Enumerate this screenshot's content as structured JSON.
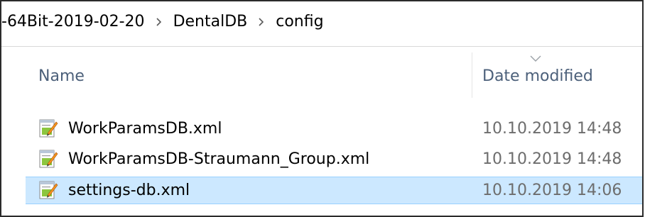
{
  "breadcrumb": {
    "items": [
      "-64Bit-2019-02-20",
      "DentalDB",
      "config"
    ]
  },
  "columns": {
    "name": "Name",
    "date_modified": "Date modified",
    "sort_icon": "chevron-down-icon"
  },
  "files": [
    {
      "name": "WorkParamsDB.xml",
      "date": "10.10.2019 14:48",
      "icon": "xml-notepad-file-icon",
      "selected": false
    },
    {
      "name": "WorkParamsDB-Straumann_Group.xml",
      "date": "10.10.2019 14:48",
      "icon": "xml-notepad-file-icon",
      "selected": false
    },
    {
      "name": "settings-db.xml",
      "date": "10.10.2019 14:06",
      "icon": "xml-notepad-file-icon",
      "selected": true
    }
  ],
  "colors": {
    "selection_bg": "#cce8ff",
    "selection_border": "#99d1ff",
    "header_text": "#4c607a",
    "date_text": "#6d6d6d"
  }
}
